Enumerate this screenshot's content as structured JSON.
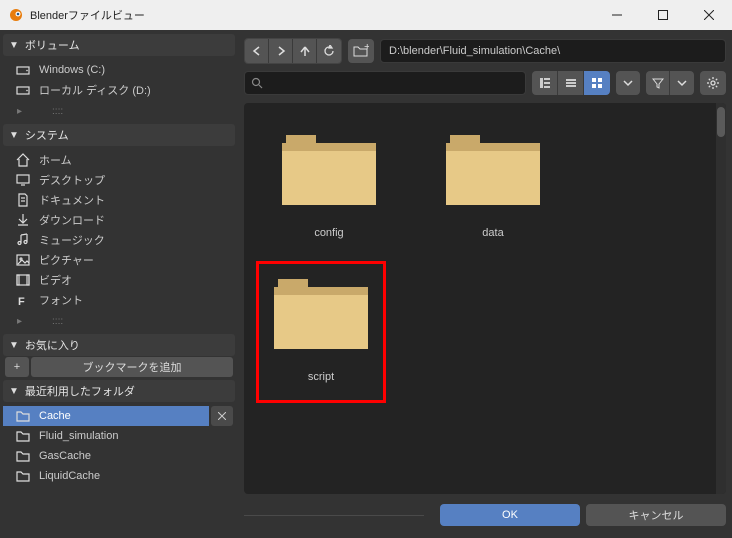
{
  "titlebar": {
    "title": "Blenderファイルビュー"
  },
  "sidebar": {
    "volumes": {
      "title": "ボリューム",
      "items": [
        {
          "label": "Windows (C:)",
          "icon": "disk"
        },
        {
          "label": "ローカル ディスク (D:)",
          "icon": "disk"
        }
      ]
    },
    "system": {
      "title": "システム",
      "items": [
        {
          "label": "ホーム",
          "icon": "home"
        },
        {
          "label": "デスクトップ",
          "icon": "desktop"
        },
        {
          "label": "ドキュメント",
          "icon": "document"
        },
        {
          "label": "ダウンロード",
          "icon": "download"
        },
        {
          "label": "ミュージック",
          "icon": "music"
        },
        {
          "label": "ピクチャー",
          "icon": "picture"
        },
        {
          "label": "ビデオ",
          "icon": "video"
        },
        {
          "label": "フォント",
          "icon": "font"
        }
      ]
    },
    "favorites": {
      "title": "お気に入り",
      "add_label": "ブックマークを追加"
    },
    "recent": {
      "title": "最近利用したフォルダ",
      "items": [
        {
          "label": "Cache",
          "selected": true
        },
        {
          "label": "Fluid_simulation"
        },
        {
          "label": "GasCache"
        },
        {
          "label": "LiquidCache"
        }
      ]
    }
  },
  "path": "D:\\blender\\Fluid_simulation\\Cache\\",
  "files": [
    {
      "name": "config",
      "highlighted": false
    },
    {
      "name": "data",
      "highlighted": false
    },
    {
      "name": "script",
      "highlighted": true
    }
  ],
  "footer": {
    "ok": "OK",
    "cancel": "キャンセル"
  }
}
